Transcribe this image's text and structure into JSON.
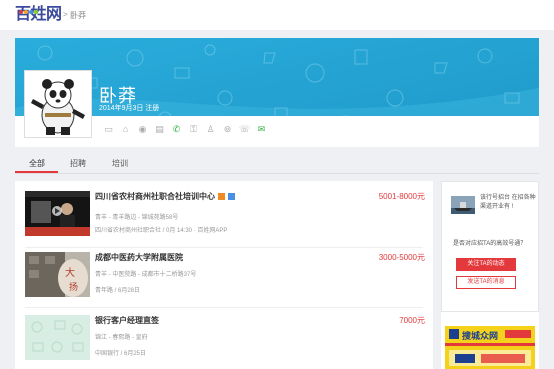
{
  "header": {
    "logo_text": "百姓网",
    "breadcrumb_sep": ">",
    "breadcrumb_current": "卧莽"
  },
  "profile": {
    "name": "卧莽",
    "joined": "2014年9月3日 注册",
    "banner_color": "#29a9d6"
  },
  "tabs": [
    {
      "label": "全部",
      "active": true
    },
    {
      "label": "招聘",
      "active": false
    },
    {
      "label": "培训",
      "active": false
    }
  ],
  "jobs": [
    {
      "title": "四川省农村商州社职合社培训中心",
      "salary": "5001-8000元",
      "meta1": "青羊 - 青羊路边 - 锦城苑路58号",
      "meta2": "四川省农村商州社职合社 / 0月 14:30 · 百姓网APP"
    },
    {
      "title": "成都中医药大学附属医院",
      "salary": "3000-5000元",
      "meta1": "青羊 - 中医院路 - 成都市十二桥路37号",
      "meta2": "青年路 / 6月28日"
    },
    {
      "title": "银行客户经理直签",
      "salary": "7000元",
      "meta1": "锦江 - 春熙路 - 皇府",
      "meta2": "中国银行 / 6月25日"
    }
  ],
  "sidebar": {
    "info_text": "该行号招台 在招各种渠道开业有 !",
    "question": "是否对应招TA的高效号通？",
    "follow_label": "关注TA的动态",
    "apply_label": "发送TA的消息",
    "ad_text": "搜城众网"
  },
  "colors": {
    "accent": "#e4393c",
    "banner": "#29a9d6",
    "brand": "#3a4a9c"
  }
}
